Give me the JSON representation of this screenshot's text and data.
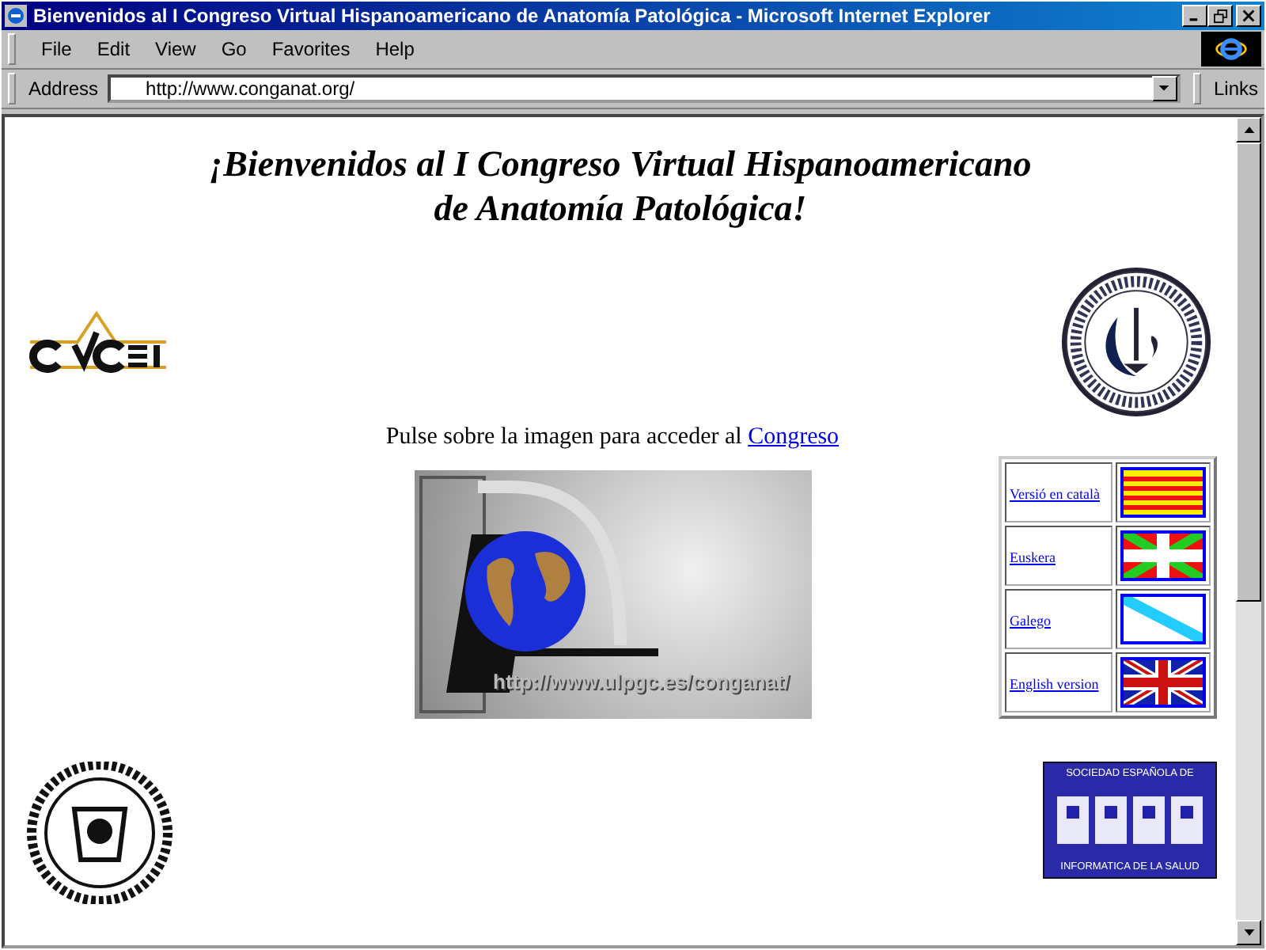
{
  "window": {
    "title": "Bienvenidos al I Congreso Virtual Hispanoamericano de Anatomía Patológica - Microsoft Internet Explorer"
  },
  "menu": [
    "File",
    "Edit",
    "View",
    "Go",
    "Favorites",
    "Help"
  ],
  "address_bar": {
    "label": "Address",
    "value": "http://www.conganat.org/",
    "links": "Links"
  },
  "page": {
    "heading_lines": [
      "¡Bienvenidos al I Congreso Virtual Hispanoamericano",
      "de Anatomía Patológica!"
    ],
    "intro": "Pulse sobre la imagen para acceder al",
    "intro_link": "Congreso",
    "banner_url": "http://www.ulpgc.es/conganat/",
    "seis_logo": {
      "top": "SOCIEDAD ESPAÑOLA DE",
      "bottom": "INFORMATICA DE LA SALUD"
    },
    "languages": [
      {
        "label": "Versió en català"
      },
      {
        "label": "Euskera"
      },
      {
        "label": "Galego"
      },
      {
        "label": "English version"
      }
    ]
  }
}
